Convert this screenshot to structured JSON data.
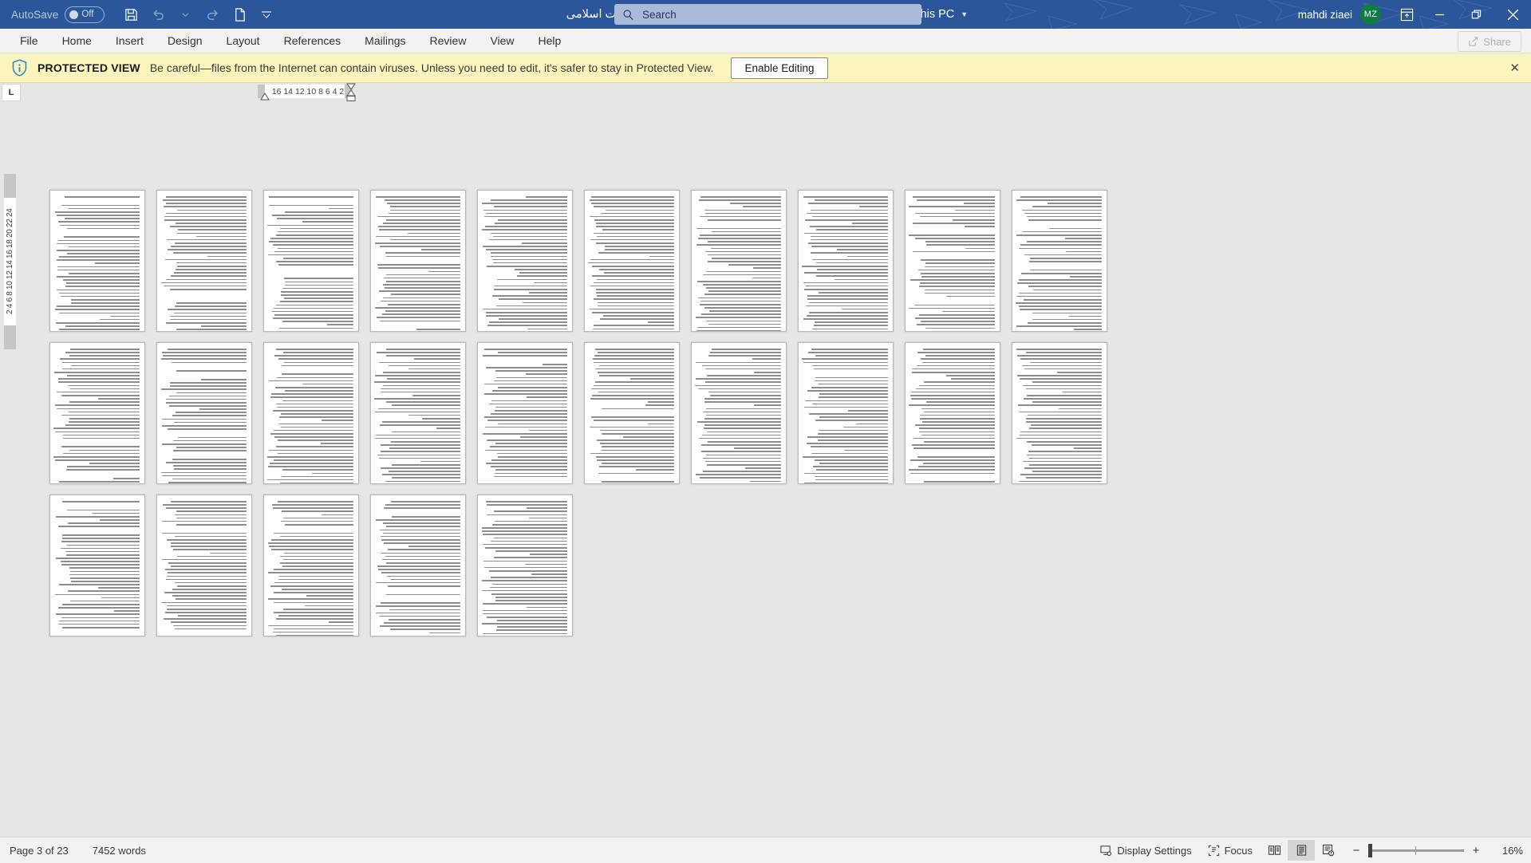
{
  "titlebar": {
    "autosave_label": "AutoSave",
    "autosave_state": "Off",
    "doc_title": "مبانی انسان شناختی تعلیم و تربیت اسلامی",
    "protected_view": "Protected View",
    "saved_state": "Saved to this PC",
    "dash": "-",
    "search_placeholder": "Search",
    "user_name": "mahdi ziaei",
    "user_initials": "MZ",
    "icons": {
      "save": "save-icon",
      "undo": "undo-icon",
      "undo_caret": "chevron-down-icon",
      "redo": "redo-icon",
      "new": "new-document-icon",
      "customize": "customize-qat-icon",
      "search": "search-icon",
      "ribbon_display": "ribbon-display-options-icon",
      "minimize": "minimize-icon",
      "restore": "restore-icon",
      "close": "close-icon"
    }
  },
  "ribbon": {
    "tabs": [
      "File",
      "Home",
      "Insert",
      "Design",
      "Layout",
      "References",
      "Mailings",
      "Review",
      "View",
      "Help"
    ],
    "share_label": "Share",
    "share_icon": "share-icon"
  },
  "protected_view": {
    "icon": "shield-info-icon",
    "title": "PROTECTED VIEW",
    "message": "Be careful—files from the Internet can contain viruses. Unless you need to edit, it's safer to stay in Protected View.",
    "button_label": "Enable Editing",
    "close_label": "✕"
  },
  "rulers": {
    "tab_selector_glyph": "L",
    "horizontal_ticks": "16 14 12 10  8   6   4   2",
    "vertical_top_tick": "2",
    "vertical_ticks": "2  4  6  8 10 12 14 16 18 20 22 24"
  },
  "document": {
    "page_count_visible": 25
  },
  "statusbar": {
    "page_indicator": "Page 3 of 23",
    "word_count": "7452 words",
    "display_settings": "Display Settings",
    "display_settings_icon": "display-settings-icon",
    "focus": "Focus",
    "focus_icon": "focus-icon",
    "read_mode_icon": "read-mode-icon",
    "print_layout_icon": "print-layout-icon",
    "web_layout_icon": "web-layout-icon",
    "zoom_out": "−",
    "zoom_in": "+",
    "zoom_value": "16%"
  },
  "colors": {
    "title_bar": "#2b579a",
    "protected_bar": "#fcf4bd",
    "accent_avatar": "#107c41",
    "canvas": "#e6e6e6"
  }
}
